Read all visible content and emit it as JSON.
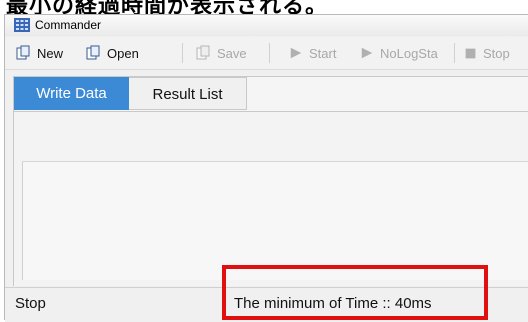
{
  "caption": {
    "text": "最小の経過時間が表示される。"
  },
  "window": {
    "title": "Commander"
  },
  "toolbar": {
    "new_label": "New",
    "open_label": "Open",
    "save_label": "Save",
    "start_label": "Start",
    "nolog_label": "NoLogSta",
    "stop_label": "Stop"
  },
  "tabs": [
    {
      "label": "Write Data",
      "active": true
    },
    {
      "label": "Result List",
      "active": false
    }
  ],
  "status": {
    "state": "Stop",
    "message": "The minimum of Time  :: 40ms"
  },
  "colors": {
    "tab_active": "#3c8ad6",
    "highlight": "#e01010"
  },
  "icons": {
    "app": "grid-app-icon",
    "new": "new-doc-icon",
    "open": "open-doc-icon",
    "save": "save-doc-icon",
    "start": "play-icon",
    "nolog": "play-icon",
    "stop": "stop-square-icon"
  }
}
